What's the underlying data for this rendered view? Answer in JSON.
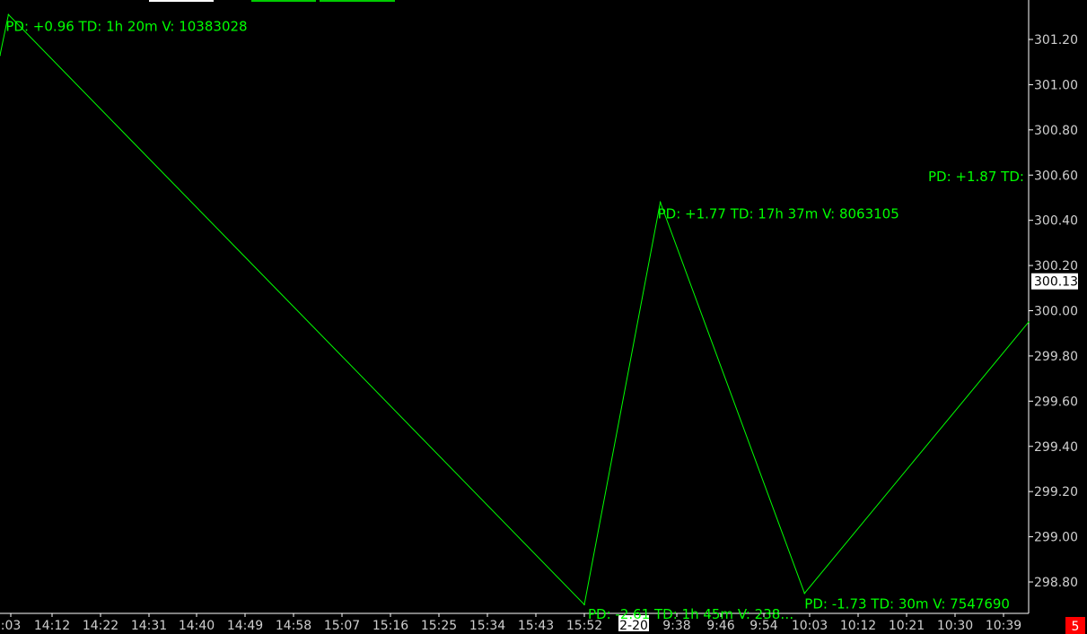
{
  "colors": {
    "background": "#000000",
    "line": "#00ff00",
    "annotation_text": "#00ff00",
    "axis_text": "#cfcfcf",
    "axis_line": "#ffffff",
    "price_label_bg": "#ffffff",
    "price_label_text": "#000000",
    "highlight_label_bg": "#ffffff",
    "highlight_label_text": "#000000",
    "badge_bg": "#ff0000",
    "badge_text": "#ffffff"
  },
  "chart_data": {
    "type": "line",
    "title": "",
    "xlabel": "",
    "ylabel": "",
    "ylim": [
      298.7,
      301.4
    ],
    "grid": false,
    "y_ticks": [
      "301.20",
      "301.00",
      "300.80",
      "300.60",
      "300.40",
      "300.20",
      "300.00",
      "299.80",
      "299.60",
      "299.40",
      "299.20",
      "299.00",
      "298.80"
    ],
    "x_ticks": [
      ":03",
      "14:12",
      "14:22",
      "14:31",
      "14:40",
      "14:49",
      "14:58",
      "15:07",
      "15:16",
      "15:25",
      "15:34",
      "15:43",
      "15:52",
      "2-20",
      "9:38",
      "9:46",
      "9:54",
      "10:03",
      "10:12",
      "10:21",
      "10:30",
      "10:39"
    ],
    "highlighted_x_tick": "2-20",
    "series": [
      {
        "x": [
          "13:57",
          "14:03",
          "15:52",
          "9:35",
          "10:02",
          "10:45"
        ],
        "values": [
          301.13,
          301.31,
          298.7,
          300.48,
          298.75,
          299.95
        ]
      }
    ],
    "annotations": [
      {
        "text": "PD: +0.96  TD: 1h 20m  V: 10383028",
        "x": "14:03",
        "y": 301.31
      },
      {
        "text": "PD: -2.61  TD: 1h 45m  V: 238…",
        "x": "15:52",
        "y": 298.7
      },
      {
        "text": "PD: +1.77  TD: 17h 37m  V: 8063105",
        "x": "9:35",
        "y": 300.48
      },
      {
        "text": "PD: -1.73  TD: 30m  V: 7547690",
        "x": "10:02",
        "y": 298.75
      },
      {
        "text": "PD: +1.87  TD:",
        "x": "10:45",
        "y": 299.95
      }
    ],
    "last_price_label": "300.13",
    "corner_badge": "5"
  }
}
